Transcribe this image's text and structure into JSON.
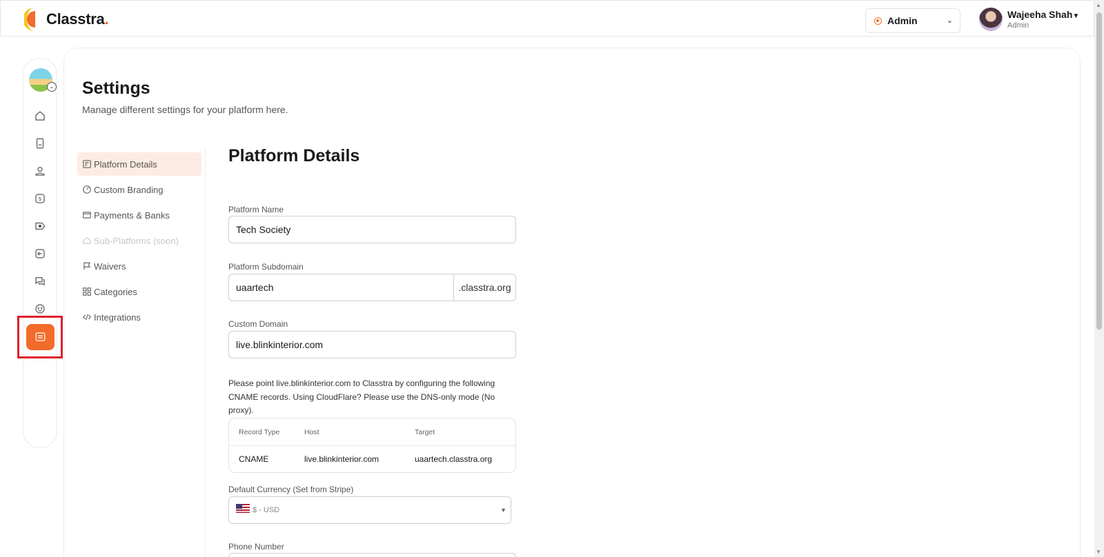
{
  "app": {
    "logo_text": "Classtra",
    "logo_dot": ".",
    "brand_color": "#f26b2a"
  },
  "header": {
    "role_select": {
      "value": "Admin"
    },
    "user": {
      "name": "Wajeeha Shah",
      "role": "Admin"
    }
  },
  "rail": {
    "items": [
      {
        "icon": "home-icon"
      },
      {
        "icon": "book-icon"
      },
      {
        "icon": "user-icon"
      },
      {
        "icon": "dollar-icon"
      },
      {
        "icon": "tag-icon"
      },
      {
        "icon": "arrow-left-icon"
      },
      {
        "icon": "chat-icon"
      },
      {
        "icon": "smile-icon"
      },
      {
        "icon": "settings-list-icon",
        "active": true
      }
    ]
  },
  "page": {
    "title": "Settings",
    "subtitle": "Manage different settings for your platform here."
  },
  "settings_nav": {
    "items": [
      {
        "label": "Platform Details",
        "icon": "document-icon",
        "active": true
      },
      {
        "label": "Custom Branding",
        "icon": "palette-icon"
      },
      {
        "label": "Payments & Banks",
        "icon": "card-icon"
      },
      {
        "label": "Sub-Platforms (soon)",
        "icon": "house-icon",
        "disabled": true
      },
      {
        "label": "Waivers",
        "icon": "flag-icon"
      },
      {
        "label": "Categories",
        "icon": "grid-icon"
      },
      {
        "label": "Integrations",
        "icon": "code-icon"
      }
    ]
  },
  "form": {
    "section_title": "Platform Details",
    "platform_name": {
      "label": "Platform Name",
      "value": "Tech Society"
    },
    "platform_subdomain": {
      "label": "Platform Subdomain",
      "value": "uaartech",
      "suffix": ".classtra.org"
    },
    "custom_domain": {
      "label": "Custom Domain",
      "value": "live.blinkinterior.com"
    },
    "help_text": "Please point live.blinkinterior.com to Classtra by configuring the following CNAME records. Using CloudFlare? Please use the DNS-only mode (No proxy).",
    "dns_table": {
      "headers": [
        "Record Type",
        "Host",
        "Target"
      ],
      "rows": [
        [
          "CNAME",
          "live.blinkinterior.com",
          "uaartech.classtra.org"
        ]
      ]
    },
    "default_currency": {
      "label": "Default Currency (Set from Stripe)",
      "value": "$ - USD"
    },
    "phone_number": {
      "label": "Phone Number",
      "value": ""
    }
  }
}
